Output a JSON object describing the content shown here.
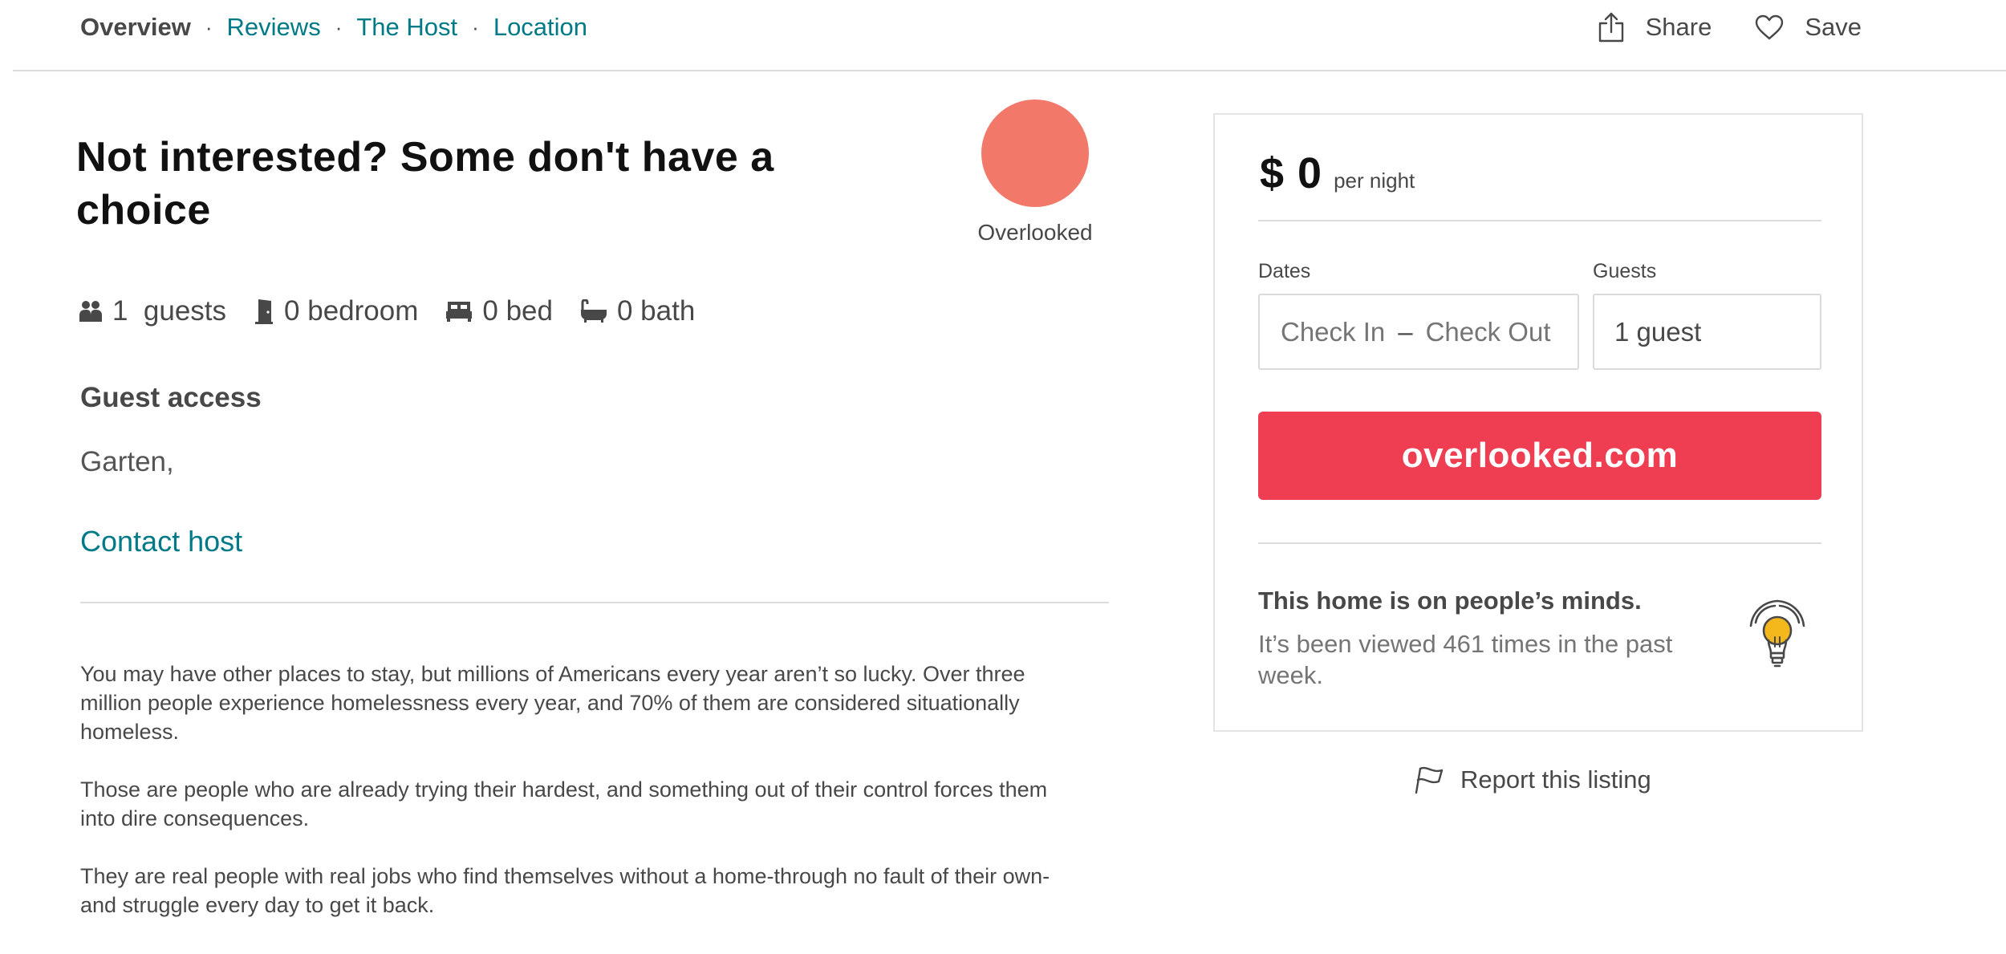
{
  "nav": {
    "links": [
      {
        "label": "Overview"
      },
      {
        "label": "Reviews"
      },
      {
        "label": "The Host"
      },
      {
        "label": "Location"
      }
    ],
    "separator": "·",
    "share_label": "Share",
    "save_label": "Save"
  },
  "listing": {
    "title": "Not interested? Some don't have a choice",
    "host_name": "Overlooked",
    "amenities": {
      "guests": "1  guests",
      "bedroom": "0 bedroom",
      "bed": "0 bed",
      "bath": "0 bath"
    },
    "guest_access_heading": "Guest access",
    "guest_access_value": "Garten,",
    "contact_host": "Contact host",
    "description": [
      "You may have other places to stay, but millions of Americans every year aren’t so lucky. Over three million people experience homelessness every year, and 70% of them are considered situationally homeless.",
      "Those are people who are already trying their hardest, and something out of their control forces them into dire consequences.",
      "They are real people with real jobs who find themselves without a home-through no fault of their own-and struggle every day to get it back."
    ]
  },
  "booking": {
    "price": "$ 0",
    "per_night": "per night",
    "dates_label": "Dates",
    "check_in_placeholder": "Check In",
    "dash": "–",
    "check_out_placeholder": "Check Out",
    "guests_label": "Guests",
    "guests_value": "1 guest",
    "button_label": "overlooked.com",
    "minds_heading": "This home is on people’s minds.",
    "minds_text": "It’s been viewed 461 times in the past week."
  },
  "report_label": "Report this listing",
  "colors": {
    "accent_teal": "#007a87",
    "button_red": "#ef3d52",
    "avatar_coral": "#f2786a",
    "bulb_yellow": "#f5b81c"
  },
  "icons": {
    "share": "share-icon",
    "save": "heart-icon",
    "guests": "guests-icon",
    "bedroom": "door-icon",
    "bed": "bed-icon",
    "bath": "bathtub-icon",
    "bulb": "lightbulb-icon",
    "report": "flag-icon"
  }
}
